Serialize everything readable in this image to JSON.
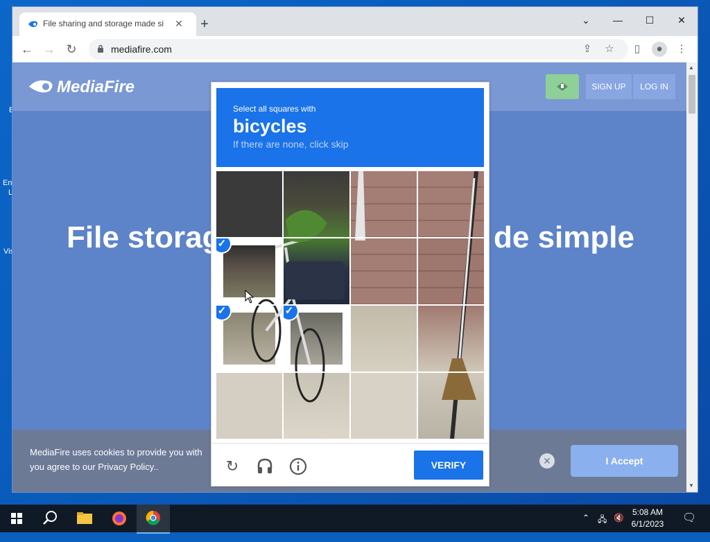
{
  "desktop": {
    "icon_labels": [
      "E",
      "En",
      "L",
      "Vis"
    ]
  },
  "browser": {
    "tab_title": "File sharing and storage made si",
    "url": "mediafire.com",
    "new_tab": "+",
    "window_controls": {
      "minimize": "⌄",
      "min": "—",
      "max": "☐",
      "close": "✕"
    }
  },
  "page": {
    "logo": "MediaFire",
    "sign_up": "SIGN UP",
    "log_in": "LOG IN",
    "headline_left": "File storag",
    "headline_right": "de simple",
    "cookie_text": "MediaFire uses cookies to provide you with",
    "cookie_text_2": "you agree to our Privacy Policy..",
    "accept": "I Accept"
  },
  "captcha": {
    "instruction": "Select all squares with",
    "target": "bicycles",
    "hint": "If there are none, click skip",
    "verify": "VERIFY",
    "selected_tiles": [
      4,
      8,
      9
    ]
  },
  "taskbar": {
    "clock_time": "5:08 AM",
    "clock_date": "6/1/2023"
  },
  "colors": {
    "accent": "#1a73e8",
    "page_bg": "#5d83c9"
  }
}
